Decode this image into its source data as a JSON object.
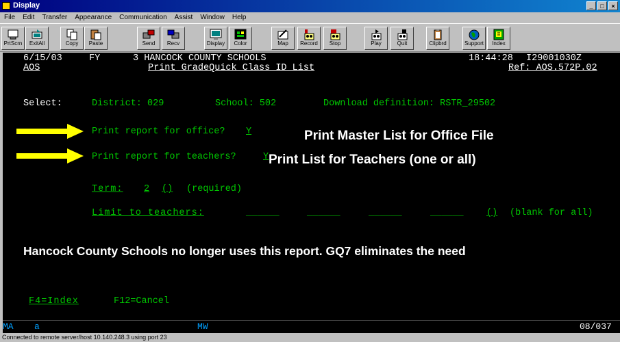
{
  "window": {
    "title": "Display"
  },
  "menu": [
    "File",
    "Edit",
    "Transfer",
    "Appearance",
    "Communication",
    "Assist",
    "Window",
    "Help"
  ],
  "toolbar": [
    {
      "label": "PrtScrn",
      "icon": "print-screen-icon"
    },
    {
      "label": "ExitAll",
      "icon": "exit-all-icon"
    },
    {
      "label": "Copy",
      "icon": "copy-icon"
    },
    {
      "label": "Paste",
      "icon": "paste-icon"
    },
    {
      "label": "Send",
      "icon": "send-icon"
    },
    {
      "label": "Recv",
      "icon": "receive-icon"
    },
    {
      "label": "Display",
      "icon": "display-icon"
    },
    {
      "label": "Color",
      "icon": "color-icon"
    },
    {
      "label": "Map",
      "icon": "map-icon"
    },
    {
      "label": "Record",
      "icon": "record-icon"
    },
    {
      "label": "Stop",
      "icon": "stop-icon"
    },
    {
      "label": "Play",
      "icon": "play-icon"
    },
    {
      "label": "Quit",
      "icon": "quit-icon"
    },
    {
      "label": "Clipbrd",
      "icon": "clipboard-icon"
    },
    {
      "label": "Support",
      "icon": "support-globe-icon"
    },
    {
      "label": "Index",
      "icon": "index-icon"
    }
  ],
  "screen": {
    "date": "6/15/03",
    "fy": "FY",
    "system": "3 HANCOCK COUNTY SCHOOLS",
    "time": "18:44:28",
    "terminal_id": "I29001030Z",
    "module": "AOS",
    "title": "Print GradeQuick Class ID List",
    "ref": "Ref: AOS.572P.02",
    "select_label": "Select:",
    "district": "District: 029",
    "school": "School: 502",
    "download_def": "Download definition: RSTR_29502",
    "office_prompt": "Print report for office?",
    "office_value": "Y",
    "teachers_prompt": "Print report for teachers?",
    "teachers_value": "Y",
    "term_label": "Term:",
    "term_value": "2",
    "term_help": "()",
    "term_note": "(required)",
    "limit_label": "Limit to teachers:",
    "limit_blank1": "______",
    "limit_blank2": "______",
    "limit_blank3": "______",
    "limit_blank4": "______",
    "limit_help": "()",
    "limit_note": "(blank for all)",
    "f4": "F4=Index",
    "f12": "F12=Cancel"
  },
  "annotations": {
    "office": "Print Master List for Office File",
    "teachers": "Print List for Teachers (one or all)",
    "note": "Hancock County Schools no longer uses this report.  GQ7 eliminates the need"
  },
  "status_line": {
    "mode": "MA",
    "a": "a",
    "mw": "MW",
    "position": "08/037"
  },
  "status_bar": "Connected to remote server/host 10.140.248.3 using port 23",
  "colors": {
    "terminal_bg": "#000000",
    "terminal_green": "#00c800",
    "terminal_white": "#ffffff",
    "arrow": "#ffff00"
  }
}
